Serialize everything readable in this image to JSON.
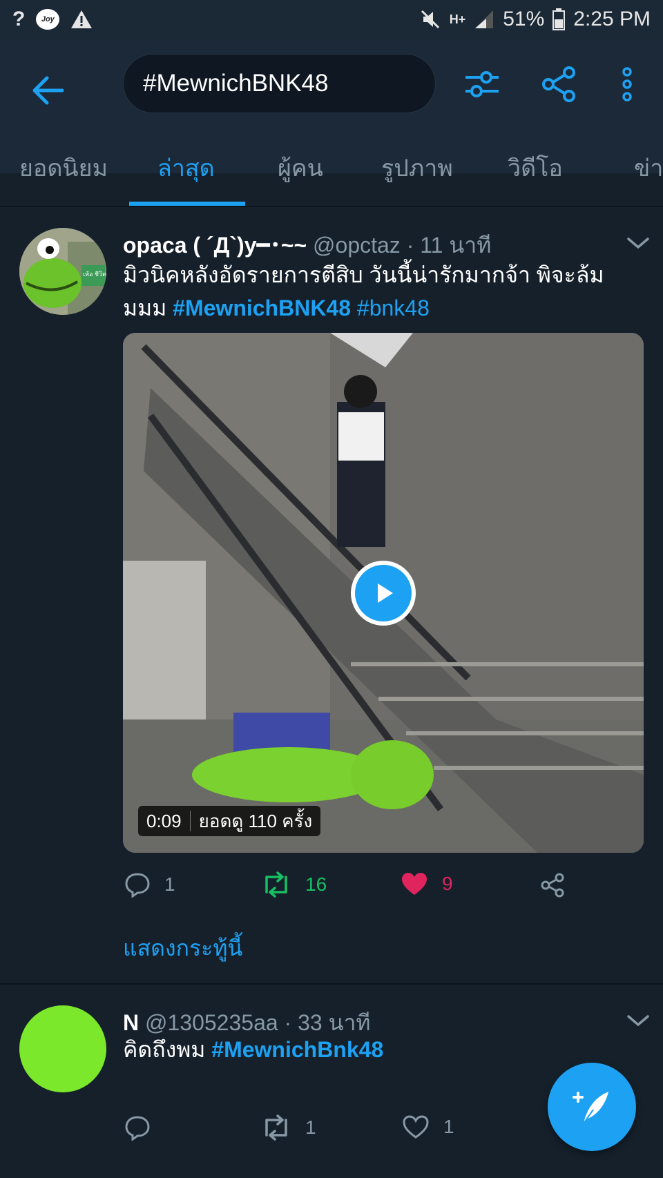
{
  "status_bar": {
    "battery": "51%",
    "time": "2:25 PM",
    "network": "H+"
  },
  "header": {
    "search_query": "#MewnichBNK48"
  },
  "tabs": [
    {
      "label": "ยอดนิยม"
    },
    {
      "label": "ล่าสุด"
    },
    {
      "label": "ผู้คน"
    },
    {
      "label": "รูปภาพ"
    },
    {
      "label": "วิดีโอ"
    },
    {
      "label": "ข่าว"
    }
  ],
  "tweets": [
    {
      "name": "opaca ( ´Д`)y━･~~",
      "handle": "@opctaz",
      "time": "· 11 นาที",
      "text_plain": "มิวนิคหลังอัดรายการตีสิบ วันนี้น่ารักมากจ้า พิจะล้มมมม ",
      "hashtag_1": "#MewnichBNK48",
      "hashtag_2": "#bnk48",
      "avatar_label": "เห้อ ชีวิต",
      "video": {
        "duration": "0:09",
        "views": "ยอดดู 110 ครั้ง"
      },
      "replies": "1",
      "retweets": "16",
      "likes": "9",
      "show_thread": "แสดงกระทู้นี้"
    },
    {
      "name": "N",
      "handle": "@1305235aa",
      "time": "· 33 นาที",
      "text_plain": "คิดถึงพม ",
      "hashtag_1": "#MewnichBnk48",
      "replies": "",
      "retweets": "1",
      "likes": "1",
      "avatar_color": "#7be82b"
    }
  ],
  "colors": {
    "accent": "#1da1f2",
    "retweet": "#17bf63",
    "like": "#e0245e",
    "background": "#15202b"
  }
}
